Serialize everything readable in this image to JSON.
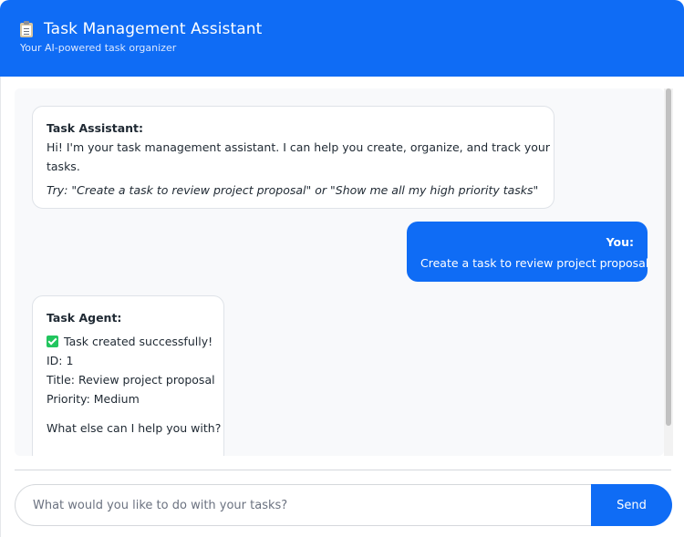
{
  "header": {
    "title": "Task Management Assistant",
    "subtitle": "Your AI-powered task organizer",
    "icon": "clipboard-icon"
  },
  "messages": {
    "welcome": {
      "sender": "Task Assistant:",
      "line1": "Hi! I'm your task management assistant. I can help you create, organize, and track your",
      "line2": "tasks.",
      "hint": "Try: \"Create a task to review project proposal\" or \"Show me all my high priority tasks\""
    },
    "user": {
      "sender": "You:",
      "text": "Create a task to review project proposal"
    },
    "agent": {
      "sender": "Task Agent:",
      "status_icon": "check-icon",
      "status": "Task created successfully!",
      "id_line": "ID: 1",
      "title_line": "Title: Review project proposal",
      "priority_line": "Priority: Medium",
      "followup": "What else can I help you with?"
    }
  },
  "composer": {
    "placeholder": "What would you like to do with your tasks?",
    "send_label": "Send"
  },
  "colors": {
    "accent": "#0f6cf5",
    "check": "#22c55e"
  }
}
